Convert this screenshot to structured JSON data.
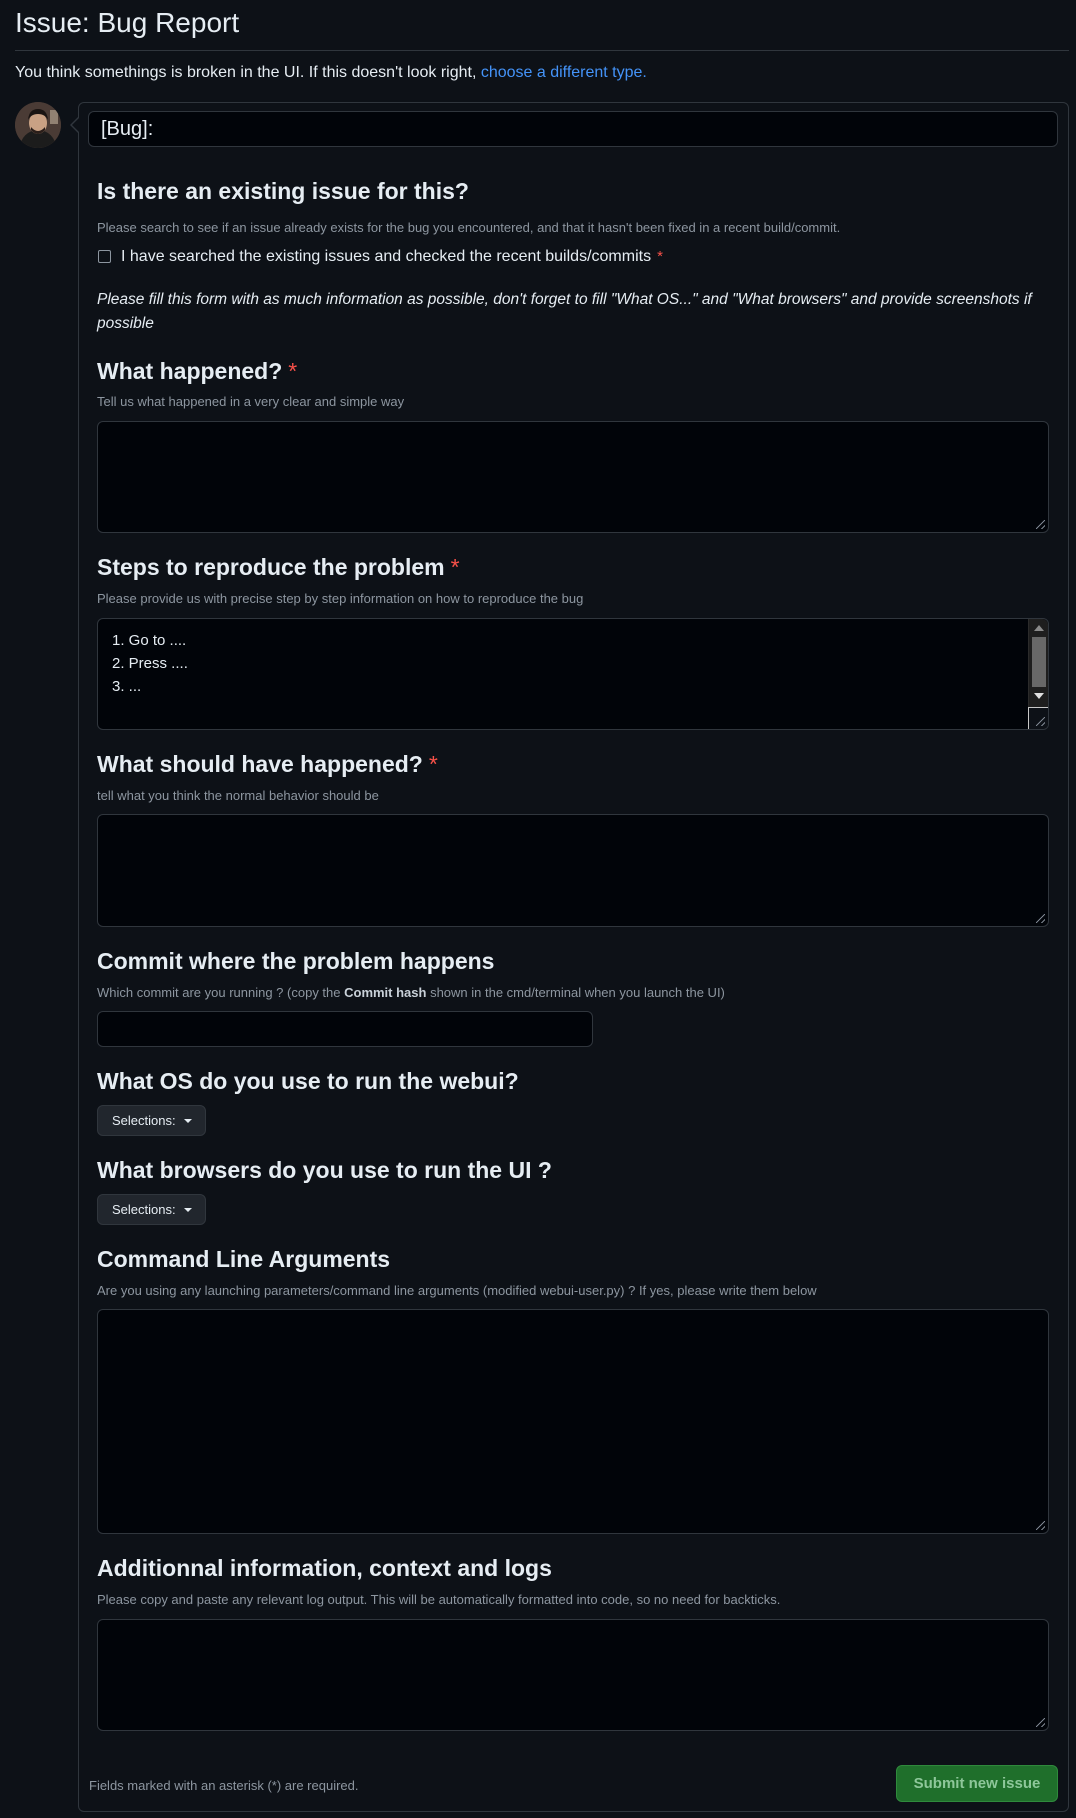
{
  "page": {
    "title": "Issue: Bug Report",
    "subtitle_text": "You think somethings is broken in the UI. If this doesn't look right, ",
    "subtitle_link": "choose a different type."
  },
  "title_input": {
    "value": "[Bug]:"
  },
  "sections": {
    "existing": {
      "heading": "Is there an existing issue for this?",
      "description": "Please search to see if an issue already exists for the bug you encountered, and that it hasn't been fixed in a recent build/commit.",
      "checkbox_label": "I have searched the existing issues and checked the recent builds/commits",
      "required_mark": "*"
    },
    "note": "Please fill this form with as much information as possible, don't forget to fill \"What OS...\" and \"What browsers\" and provide screenshots if possible",
    "what_happened": {
      "heading": "What happened?",
      "required_mark": "*",
      "description": "Tell us what happened in a very clear and simple way",
      "value": ""
    },
    "steps": {
      "heading": "Steps to reproduce the problem",
      "required_mark": "*",
      "description": "Please provide us with precise step by step information on how to reproduce the bug",
      "lines": [
        "1. Go to ....",
        "2. Press ....",
        "3. ..."
      ]
    },
    "should_happen": {
      "heading": "What should have happened?",
      "required_mark": "*",
      "description": "tell what you think the normal behavior should be",
      "value": ""
    },
    "commit": {
      "heading": "Commit where the problem happens",
      "description_before": "Which commit are you running ? (copy the ",
      "description_bold": "Commit hash",
      "description_after": " shown in the cmd/terminal when you launch the UI)",
      "value": ""
    },
    "os": {
      "heading": "What OS do you use to run the webui?",
      "dropdown_label": "Selections:"
    },
    "browsers": {
      "heading": "What browsers do you use to run the UI ?",
      "dropdown_label": "Selections:"
    },
    "cmd_args": {
      "heading": "Command Line Arguments",
      "description": "Are you using any launching parameters/command line arguments (modified webui-user.py) ? If yes, please write them below",
      "value": ""
    },
    "additional": {
      "heading": "Additionnal information, context and logs",
      "description": "Please copy and paste any relevant log output. This will be automatically formatted into code, so no need for backticks.",
      "value": ""
    }
  },
  "footer": {
    "note": "Fields marked with an asterisk (*) are required.",
    "submit_label": "Submit new issue"
  },
  "colors": {
    "background": "#0d1117",
    "border": "#30363d",
    "link": "#4493f8",
    "required": "#f85149",
    "submit_bg": "#1f6f2b"
  }
}
